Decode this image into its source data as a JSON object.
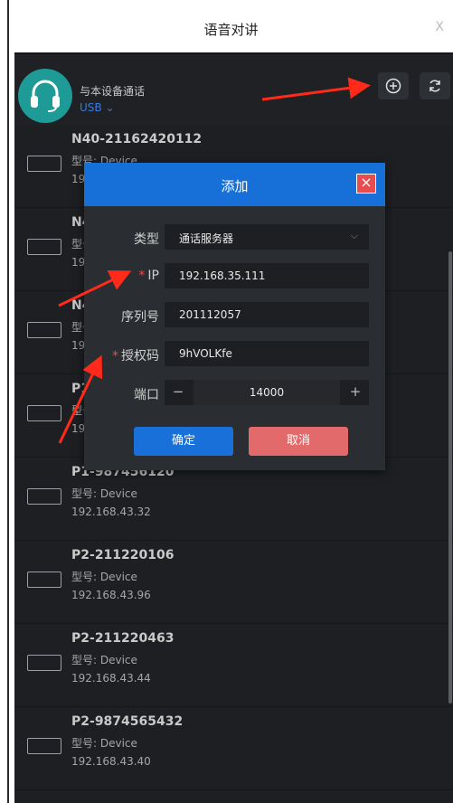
{
  "window": {
    "title": "语音对讲",
    "close_label": "X"
  },
  "header": {
    "label": "与本设备通话",
    "source": "USB"
  },
  "devices": [
    {
      "name": "N40-21162420112",
      "model": "型号: Device",
      "ip": "192.168.43.x"
    },
    {
      "name": "N4",
      "model": "型号",
      "ip": "19"
    },
    {
      "name": "N4",
      "model": "型号",
      "ip": "19"
    },
    {
      "name": "P1",
      "model": "型号",
      "ip": "19"
    },
    {
      "name": "P1-987456120",
      "model": "型号: Device",
      "ip": "192.168.43.32"
    },
    {
      "name": "P2-211220106",
      "model": "型号: Device",
      "ip": "192.168.43.96"
    },
    {
      "name": "P2-211220463",
      "model": "型号: Device",
      "ip": "192.168.43.44"
    },
    {
      "name": "P2-9874565432",
      "model": "型号: Device",
      "ip": "192.168.43.40"
    }
  ],
  "dialog": {
    "title": "添加",
    "close_label": "×",
    "fields": {
      "type_label": "类型",
      "type_value": "通话服务器",
      "ip_label": "IP",
      "ip_value": "192.168.35.111",
      "serial_label": "序列号",
      "serial_value": "201112057",
      "auth_label": "授权码",
      "auth_value": "9hVOLKfe",
      "port_label": "端口",
      "port_value": "14000",
      "required_mark": "*"
    },
    "ok_label": "确定",
    "cancel_label": "取消"
  },
  "colors": {
    "accent": "#1670d7",
    "danger": "#e84c4c",
    "cancel": "#e36a6a",
    "panel": "#1d1f22",
    "annotation": "#ff2a1a"
  }
}
